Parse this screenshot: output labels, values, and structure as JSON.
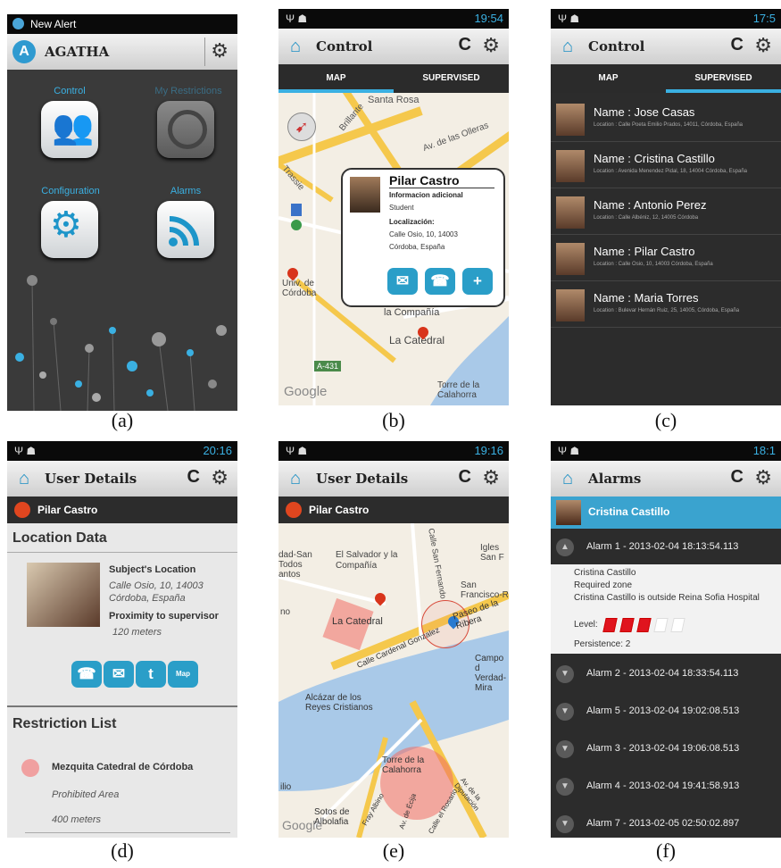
{
  "captions": {
    "a": "(a)",
    "b": "(b)",
    "c": "(c)",
    "d": "(d)",
    "e": "(e)",
    "f": "(f)"
  },
  "a": {
    "status_title": "New Alert",
    "app_title": "AGATHA",
    "tiles": [
      {
        "label": "Control",
        "icon": "users-icon"
      },
      {
        "label": "My Restrictions",
        "icon": "prohibited-icon"
      },
      {
        "label": "Configuration",
        "icon": "gears-icon"
      },
      {
        "label": "Alarms",
        "icon": "rss-icon"
      }
    ]
  },
  "b": {
    "time": "19:54",
    "title": "Control",
    "tabs": [
      "MAP",
      "SUPERVISED"
    ],
    "map_labels": {
      "santa_rosa": "Santa Rosa",
      "brillante": "Brillante",
      "olleras": "Av. de las Olleras",
      "trassie": "Trassie",
      "univ": "Univ. de Córdoba",
      "conpania": "la Compañía",
      "catedral": "La Catedral",
      "a431": "A-431",
      "torre": "Torre de la Calahorra",
      "google": "Google"
    },
    "popup": {
      "name": "Pilar Castro",
      "info_title": "Informacion adicional",
      "info": "Student",
      "loc_title": "Localización:",
      "loc1": "Calle Osio, 10, 14003",
      "loc2": "Córdoba, España"
    }
  },
  "c": {
    "time": "17:5",
    "title": "Control",
    "tabs": [
      "MAP",
      "SUPERVISED"
    ],
    "people": [
      {
        "name": "Name : Jose Casas",
        "location": "Location : Calle Poeta Emilio Prados, 14011, Córdoba, España"
      },
      {
        "name": "Name : Cristina Castillo",
        "location": "Location : Avenida Menendez Pidal, 18, 14004 Córdoba, España"
      },
      {
        "name": "Name : Antonio Perez",
        "location": "Location : Calle Albéniz, 12, 14005 Córdoba"
      },
      {
        "name": "Name : Pilar Castro",
        "location": "Location : Calle Osio, 10, 14003 Córdoba, España"
      },
      {
        "name": "Name : Maria Torres",
        "location": "Location : Bulevar Hernán Ruiz, 25, 14005, Córdoba, España"
      }
    ]
  },
  "d": {
    "time": "20:16",
    "title": "User Details",
    "user": "Pilar Castro",
    "location_header": "Location Data",
    "subject_label": "Subject's Location",
    "address1": "Calle Osio, 10, 14003",
    "address2": "Córdoba, España",
    "proximity_label": "Proximity to supervisor",
    "proximity": "120 meters",
    "map_btn": "Map",
    "restriction_header": "Restriction List",
    "restriction_name": "Mezquita Catedral de Córdoba",
    "restriction_type": "Prohibited Area",
    "restriction_dist": "400 meters"
  },
  "e": {
    "time": "19:16",
    "title": "User Details",
    "user": "Pilar Castro",
    "map_labels": {
      "san_todos": "dad-San Todos antos",
      "salvador": "El Salvador y la Compañía",
      "fernando": "Calle San Fernando",
      "igles": "Igles San F",
      "francisco": "San Francisco-R",
      "no": "no",
      "catedral": "La Catedral",
      "paseo": "Paseo de la Ribera",
      "gonzalez": "Calle Cardenal Gonzalez",
      "campo": "Campo d Verdad-Mira",
      "alcazar": "Alcázar de los Reyes Cristianos",
      "torre": "Torre de la Calahorra",
      "ilio": "ilio",
      "sotos": "Sotos de Albolafia",
      "google": "Google",
      "albino": "Fray Albino",
      "ecija": "Av. de Écija",
      "rosario": "Calle el Rosario",
      "diputacion": "Av. de la Diputación"
    }
  },
  "f": {
    "time": "18:1",
    "title": "Alarms",
    "user": "Cristina Castillo",
    "expanded_alarm": "Alarm 1 - 2013-02-04 18:13:54.113",
    "detail_name": "Cristina Castillo",
    "detail_type": "Required zone",
    "detail_msg": "Cristina Castillo is outside Reina Sofia Hospital",
    "level_label": "Level:",
    "level": 3,
    "level_max": 5,
    "persistence": "Persistence: 2",
    "alarms": [
      "Alarm 2 - 2013-02-04 18:33:54.113",
      "Alarm 5 - 2013-02-04 19:02:08.513",
      "Alarm 3 - 2013-02-04 19:06:08.513",
      "Alarm 4 - 2013-02-04 19:41:58.913",
      "Alarm 7 - 2013-02-05 02:50:02.897"
    ]
  }
}
